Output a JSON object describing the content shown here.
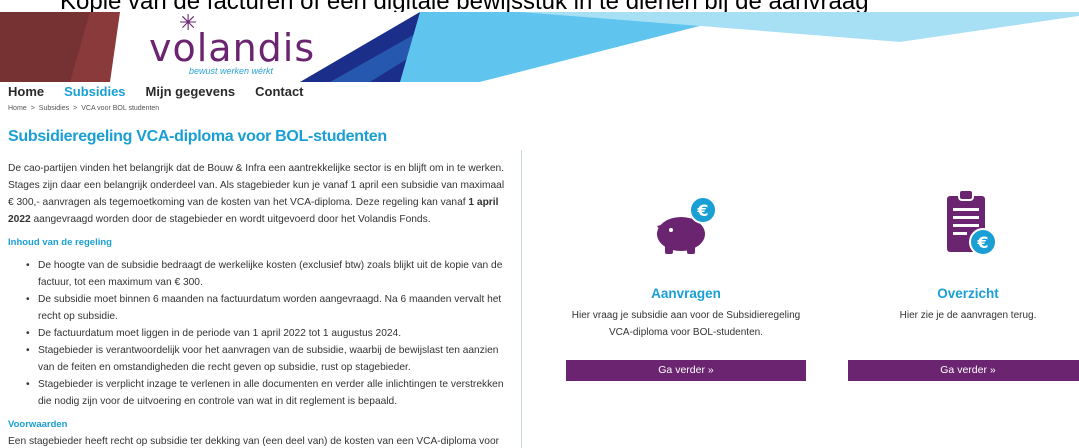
{
  "header_strip": {
    "text": "Kopie van de facturen of een digitale bewijsstuk in te dienen bij de aanvraag"
  },
  "brand": {
    "name": "volandis",
    "tagline": "bewust werken wérkt",
    "primary_color": "#6b2470",
    "accent_color": "#1a9fd5"
  },
  "nav": {
    "items": [
      {
        "label": "Home",
        "active": false
      },
      {
        "label": "Subsidies",
        "active": true
      },
      {
        "label": "Mijn gegevens",
        "active": false
      },
      {
        "label": "Contact",
        "active": false
      }
    ]
  },
  "breadcrumb": {
    "items": [
      "Home",
      "Subsidies",
      "VCA voor BOL studenten"
    ],
    "separator": ">"
  },
  "page": {
    "title": "Subsidieregeling VCA-diploma voor BOL-studenten",
    "intro_part1": "De cao-partijen vinden het belangrijk dat de Bouw & Infra een aantrekkelijke sector is en blijft om in te werken. Stages zijn daar een belangrijk onderdeel van. Als stagebieder kun je vanaf 1 april een subsidie van maximaal € 300,- aanvragen als tegemoetkoming van de kosten van het VCA-diploma. Deze regeling kan vanaf ",
    "intro_bold": "1 april 2022",
    "intro_part2": " aangevraagd worden door de stagebieder en wordt uitgevoerd door het Volandis Fonds.",
    "section1_title": "Inhoud van de regeling",
    "bullets": [
      "De hoogte van de subsidie bedraagt de werkelijke kosten (exclusief btw) zoals blijkt uit de kopie van de factuur, tot een maximum van € 300.",
      "De subsidie moet binnen 6 maanden na factuurdatum worden aangevraagd. Na 6 maanden vervalt het recht op subsidie.",
      "De factuurdatum moet liggen in de periode van 1 april 2022 tot 1 augustus 2024.",
      "Stagebieder is verantwoordelijk voor het aanvragen van de subsidie, waarbij de bewijslast ten aanzien van de feiten en omstandigheden die recht geven op subsidie, rust op stagebieder.",
      "Stagebieder is verplicht inzage te verlenen in alle documenten en verder alle inlichtingen te verstrekken die nodig zijn voor de uitvoering en controle van wat in dit reglement is bepaald."
    ],
    "section2_title": "Voorwaarden",
    "section2_text": "Een stagebieder heeft recht op subsidie ter dekking van (een deel van) de kosten van een VCA-diploma voor een stagiair wanneer aan de volgende voorwaarden is voldaan:"
  },
  "cards": [
    {
      "icon": "piggy-bank-euro-icon",
      "title": "Aanvragen",
      "description": "Hier vraag je subsidie aan voor de Subsidieregeling VCA-diploma voor BOL-studenten.",
      "button": "Ga verder »"
    },
    {
      "icon": "clipboard-euro-icon",
      "title": "Overzicht",
      "description": "Hier zie je de aanvragen terug.",
      "button": "Ga verder »"
    }
  ]
}
